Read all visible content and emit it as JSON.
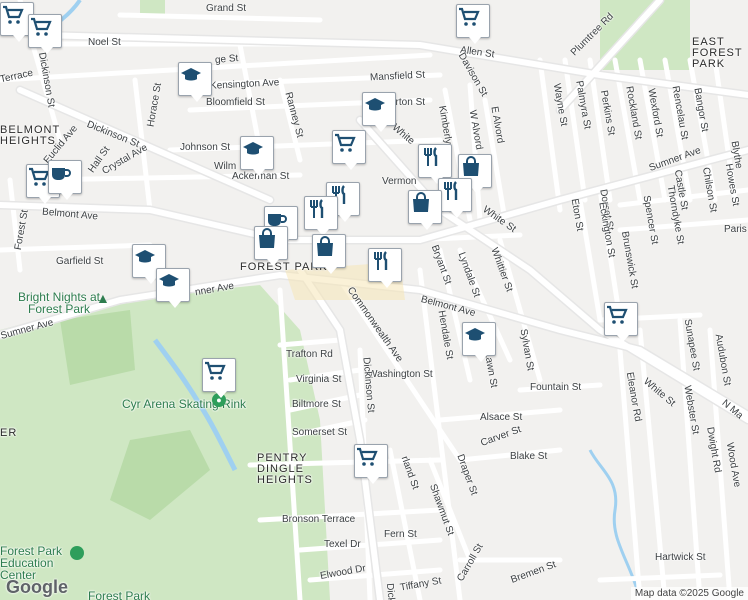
{
  "map": {
    "labels": {
      "grand_st": "Grand St",
      "noel_st": "Noel St",
      "allen_st": "Allen St",
      "plumtree_rd": "Plumtree Rd",
      "east_forest_park": "EAST FOREST PARK",
      "terrace": "Terrace",
      "ridge_st": "ge St",
      "kensington_ave": "Kensington Ave",
      "mansfield_st": "Mansfield St",
      "davison_st": "Davison St",
      "dickinson_st_north": "Dickinson St",
      "bloomfield_st": "Bloomfield St",
      "ranney_st": "Ranney St",
      "burton_st": "urton St",
      "wayne_st": "Wayne St",
      "palmyra_st": "Palmyra St",
      "perkins_st": "Perkins St",
      "rockland_st": "Rockland St",
      "wexford_st": "Wexford St",
      "rencelau_st": "Rencelau St",
      "bangor_st": "Bangor St",
      "blythe": "Blythe",
      "belmont_heights": "BELMONT HEIGHTS",
      "euclid_ave": "Euclid Ave",
      "horace_st": "Horace St",
      "dickinson_st_diag": "Dickinson St",
      "johnson_st": "Johnson St",
      "white_st_north": "White",
      "kimberly": "Kimberly",
      "w_alvord": "W Alvord",
      "e_alvord": "E Alvord",
      "sumner_ave_ne": "Sumner Ave",
      "hall_st": "Hall St",
      "crystal_ave": "Crystal Ave",
      "wilm": "Wilm",
      "ackerman_st": "Ackerman St",
      "vermont": "Vermon",
      "castle_st": "Castle St",
      "chilson_st": "Chilson St",
      "howes_st": "Howes St",
      "belmont_ave_west": "Belmont Ave",
      "forest_st": "Forest St",
      "eton_st": "Eton St",
      "dorset_st": "Dorset St",
      "eckington_st": "Eckington St",
      "spencer_st": "Spencer St",
      "thorndyke_st": "Thorndyke St",
      "paris": "Paris",
      "garfield_st": "Garfield St",
      "forest_park": "FOREST PARK",
      "bryant_st": "Bryant St",
      "lyndale_st": "Lyndale St",
      "whittier_st": "Whittier St",
      "white_st_south": "White St",
      "brunswick_st": "Brunswick St",
      "sunner_ave_west": "nner Ave",
      "bright_nights": "Bright Nights at Forest Park",
      "sumner_ave_sw": "Sumner Ave",
      "belmont_ave_east": "Belmont Ave",
      "commonwealth_ave": "Commonwealth Ave",
      "hendale_st": "Hendale St",
      "sylvan_st": "Sylvan St",
      "sunapee_st": "Sunapee St",
      "trafton_rd": "Trafton Rd",
      "virginia_st": "Virginia St",
      "washington_st": "Washington St",
      "lawn_st": "Lawn St",
      "fountain_st": "Fountain St",
      "audubon_st": "Audubon St",
      "cyr_arena": "Cyr Arena Skating Rink",
      "biltmore_st": "Biltmore St",
      "dickinson_st_south": "Dickinson St",
      "eleanor_rd": "Eleanor Rd",
      "white_st_se": "White St",
      "webster_st": "Webster St",
      "n_main": "N Ma",
      "alsace_st": "Alsace St",
      "somerset_st": "Somerset St",
      "carver_st": "Carver St",
      "blake_st": "Blake St",
      "dwight_rd": "Dwight Rd",
      "wood_ave": "Wood Ave",
      "pentry_dingle_heights": "PENTRY DINGLE HEIGHTS",
      "er": "ER",
      "garland_st": "rland St",
      "shawmut_st": "Shawmut St",
      "draper_st": "Draper St",
      "bronson_terrace": "Bronson Terrace",
      "fern_st": "Fern St",
      "texel_dr": "Texel Dr",
      "carroll_st": "Carroll St",
      "hartwick_st": "Hartwick St",
      "elwood_dr": "Elwood Dr",
      "tiffany_st": "Tiffany St",
      "bremen_st": "Bremen St",
      "forest_park_ed": "Forest Park Education Center",
      "forest_park_bottom": "Forest Park",
      "dick_bottom": "Dick"
    },
    "google_logo": "Google",
    "attribution": "Map data ©2025 Google",
    "colors": {
      "park": "#cfe7c3",
      "park_dark": "#b9dba9",
      "water": "#9fd0f0",
      "road": "#ffffff",
      "arterial": "#dcdcdc",
      "land": "#f2f1ef",
      "poi_icon": "#1e4f72"
    },
    "markers": [
      {
        "icon": "grocery-icon"
      },
      {
        "icon": "grocery-icon"
      },
      {
        "icon": "grocery-icon"
      },
      {
        "icon": "school-icon"
      },
      {
        "icon": "school-icon"
      },
      {
        "icon": "grocery-icon"
      },
      {
        "icon": "restaurant-icon"
      },
      {
        "icon": "grocery-icon"
      },
      {
        "icon": "cafe-icon"
      },
      {
        "icon": "school-icon"
      },
      {
        "icon": "restaurant-icon"
      },
      {
        "icon": "shopping-icon"
      },
      {
        "icon": "restaurant-icon"
      },
      {
        "icon": "cafe-icon"
      },
      {
        "icon": "shopping-icon"
      },
      {
        "icon": "restaurant-icon"
      },
      {
        "icon": "shopping-icon"
      },
      {
        "icon": "shopping-icon"
      },
      {
        "icon": "school-icon"
      },
      {
        "icon": "school-icon"
      },
      {
        "icon": "restaurant-icon"
      },
      {
        "icon": "grocery-icon"
      },
      {
        "icon": "school-icon"
      },
      {
        "icon": "grocery-icon"
      },
      {
        "icon": "grocery-icon"
      }
    ]
  }
}
